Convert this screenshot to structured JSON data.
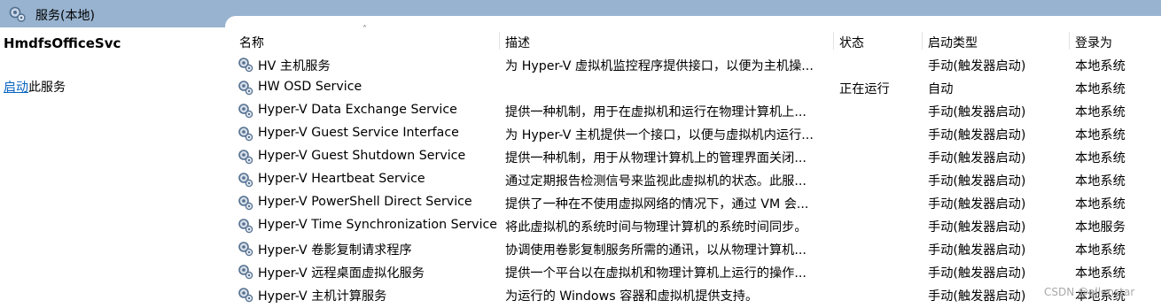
{
  "window": {
    "title": "服务(本地)",
    "icon": "services-gear-icon"
  },
  "left_panel": {
    "service_name": "HmdfsOfficeSvc",
    "action_link": "启动",
    "action_suffix": "此服务"
  },
  "columns": {
    "name": "名称",
    "description": "描述",
    "status": "状态",
    "startup_type": "启动类型",
    "logon_as": "登录为"
  },
  "services": [
    {
      "name": "HV 主机服务",
      "description": "为 Hyper-V 虚拟机监控程序提供接口，以便为主机操...",
      "status": "",
      "startup_type": "手动(触发器启动)",
      "logon_as": "本地系统"
    },
    {
      "name": "HW OSD Service",
      "description": "",
      "status": "正在运行",
      "startup_type": "自动",
      "logon_as": "本地系统"
    },
    {
      "name": "Hyper-V Data Exchange Service",
      "description": "提供一种机制，用于在虚拟机和运行在物理计算机上...",
      "status": "",
      "startup_type": "手动(触发器启动)",
      "logon_as": "本地系统"
    },
    {
      "name": "Hyper-V Guest Service Interface",
      "description": "为 Hyper-V 主机提供一个接口，以便与虚拟机内运行...",
      "status": "",
      "startup_type": "手动(触发器启动)",
      "logon_as": "本地系统"
    },
    {
      "name": "Hyper-V Guest Shutdown Service",
      "description": "提供一种机制，用于从物理计算机上的管理界面关闭...",
      "status": "",
      "startup_type": "手动(触发器启动)",
      "logon_as": "本地系统"
    },
    {
      "name": "Hyper-V Heartbeat Service",
      "description": "通过定期报告检测信号来监视此虚拟机的状态。此服...",
      "status": "",
      "startup_type": "手动(触发器启动)",
      "logon_as": "本地系统"
    },
    {
      "name": "Hyper-V PowerShell Direct Service",
      "description": "提供了一种在不使用虚拟网络的情况下，通过 VM 会...",
      "status": "",
      "startup_type": "手动(触发器启动)",
      "logon_as": "本地系统"
    },
    {
      "name": "Hyper-V Time Synchronization Service",
      "description": "将此虚拟机的系统时间与物理计算机的系统时间同步。",
      "status": "",
      "startup_type": "手动(触发器启动)",
      "logon_as": "本地服务"
    },
    {
      "name": "Hyper-V 卷影复制请求程序",
      "description": "协调使用卷影复制服务所需的通讯，以从物理计算机...",
      "status": "",
      "startup_type": "手动(触发器启动)",
      "logon_as": "本地系统"
    },
    {
      "name": "Hyper-V 远程桌面虚拟化服务",
      "description": "提供一个平台以在虚拟机和物理计算机上运行的操作...",
      "status": "",
      "startup_type": "手动(触发器启动)",
      "logon_as": "本地系统"
    },
    {
      "name": "Hyper-V 主机计算服务",
      "description": "为运行的 Windows 容器和虚拟机提供支持。",
      "status": "",
      "startup_type": "手动(触发器启动)",
      "logon_as": "本地系统"
    }
  ],
  "watermark": "CSDN @allenstar",
  "colors": {
    "titlebar": "#98b3cf",
    "link": "#0563c1"
  }
}
